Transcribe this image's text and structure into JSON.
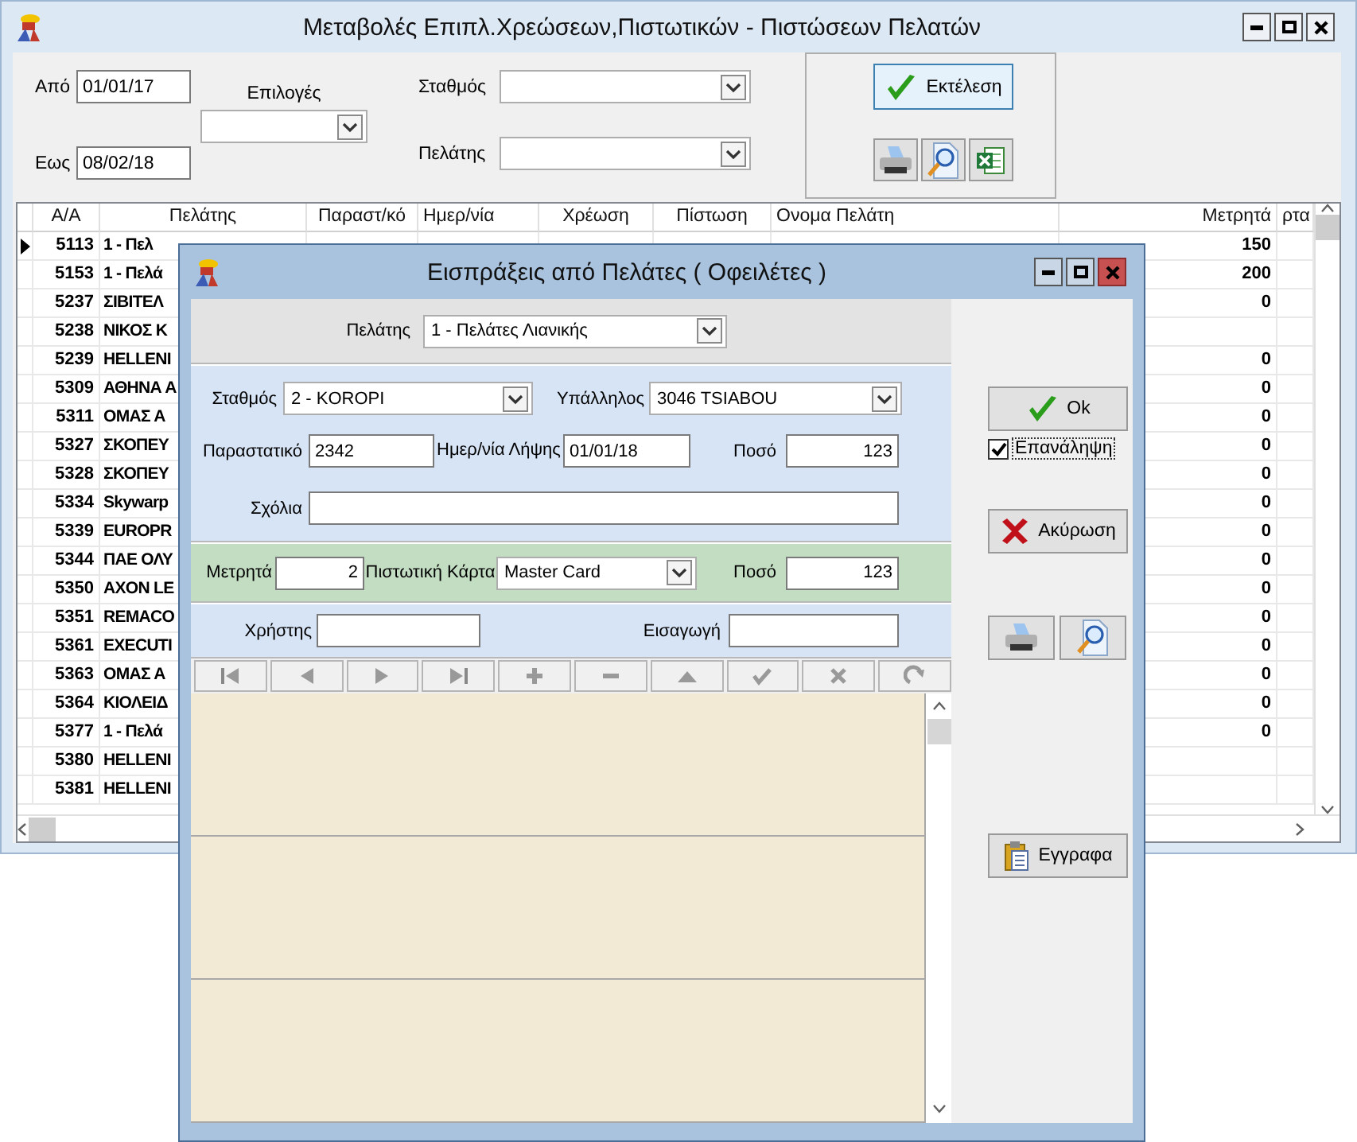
{
  "main_window": {
    "title": "Μεταβολές Επιπλ.Χρεώσεων,Πιστωτικών - Πιστώσεων Πελατών",
    "filters": {
      "from_label": "Από",
      "from_value": "01/01/17",
      "to_label": "Εως",
      "to_value": "08/02/18",
      "options_label": "Επιλογές",
      "station_label": "Σταθμός",
      "customer_label": "Πελάτης"
    },
    "execute_button": "Εκτέλεση",
    "grid": {
      "columns": [
        "Α/Α",
        "Πελάτης",
        "Παραστ/κό",
        "Ημερ/νία",
        "Χρέωση",
        "Πίστωση",
        "Ονομα Πελάτη",
        "Μετρητά",
        "ρτα"
      ],
      "rows": [
        {
          "selected": true,
          "aa": "5113",
          "customer": "1 - Πελ",
          "cash": "150"
        },
        {
          "selected": false,
          "aa": "5153",
          "customer": "1 - Πελά",
          "cash": "200"
        },
        {
          "selected": false,
          "aa": "5237",
          "customer": "ΣΙΒΙΤΕΛ",
          "cash": "0"
        },
        {
          "selected": false,
          "aa": "5238",
          "customer": "ΝΙΚΟΣ Κ"
        },
        {
          "selected": false,
          "aa": "5239",
          "customer": "HELLENI",
          "cash": "0"
        },
        {
          "selected": false,
          "aa": "5309",
          "customer": "ΑΘΗΝΑ Α",
          "cash": "0"
        },
        {
          "selected": false,
          "aa": "5311",
          "customer": "ΟΜΑΣ Α",
          "cash": "0"
        },
        {
          "selected": false,
          "aa": "5327",
          "customer": "ΣΚΟΠΕΥ",
          "cash": "0"
        },
        {
          "selected": false,
          "aa": "5328",
          "customer": "ΣΚΟΠΕΥ",
          "cash": "0"
        },
        {
          "selected": false,
          "aa": "5334",
          "customer": "Skywarp",
          "cash": "0"
        },
        {
          "selected": false,
          "aa": "5339",
          "customer": "EUROPR",
          "cash": "0"
        },
        {
          "selected": false,
          "aa": "5344",
          "customer": "ΠΑΕ ΟΛΥ",
          "cash": "0"
        },
        {
          "selected": false,
          "aa": "5350",
          "customer": "AXON LE",
          "cash": "0"
        },
        {
          "selected": false,
          "aa": "5351",
          "customer": "REMACO",
          "cash": "0"
        },
        {
          "selected": false,
          "aa": "5361",
          "customer": "EXECUTI",
          "cash": "0"
        },
        {
          "selected": false,
          "aa": "5363",
          "customer": "ΟΜΑΣ Α",
          "cash": "0"
        },
        {
          "selected": false,
          "aa": "5364",
          "customer": "ΚΙΟΛΕΙΔ",
          "cash": "0"
        },
        {
          "selected": false,
          "aa": "5377",
          "customer": "1 - Πελά",
          "cash": "0"
        },
        {
          "selected": false,
          "aa": "5380",
          "customer": "HELLENI"
        },
        {
          "selected": false,
          "aa": "5381",
          "customer": "HELLENI"
        }
      ]
    }
  },
  "dialog": {
    "title": "Εισπράξεις από Πελάτες ( Οφειλέτες )",
    "customer_label": "Πελάτης",
    "customer_value": "1 - Πελάτες Λιανικής",
    "station_label": "Σταθμός",
    "station_value": "2 - KOROPI",
    "employee_label": "Υπάλληλος",
    "employee_value": "3046 TSIABOU",
    "document_label": "Παραστατικό",
    "document_value": "2342",
    "receipt_date_label": "Ημερ/νία Λήψης",
    "receipt_date_value": "01/01/18",
    "amount_label": "Ποσό",
    "amount_value": "123",
    "comments_label": "Σχόλια",
    "cash_label": "Μετρητά",
    "cash_value": "2",
    "card_label": "Πιστωτική Κάρτα",
    "card_value": "Master Card",
    "card_amount_label": "Ποσό",
    "card_amount_value": "123",
    "user_label": "Χρήστης",
    "entry_label": "Εισαγωγή",
    "ok_button": "Ok",
    "repeat_checkbox": {
      "label": "Επανάληψη",
      "checked": true
    },
    "cancel_button": "Ακύρωση",
    "documents_button": "Εγγραφα"
  }
}
